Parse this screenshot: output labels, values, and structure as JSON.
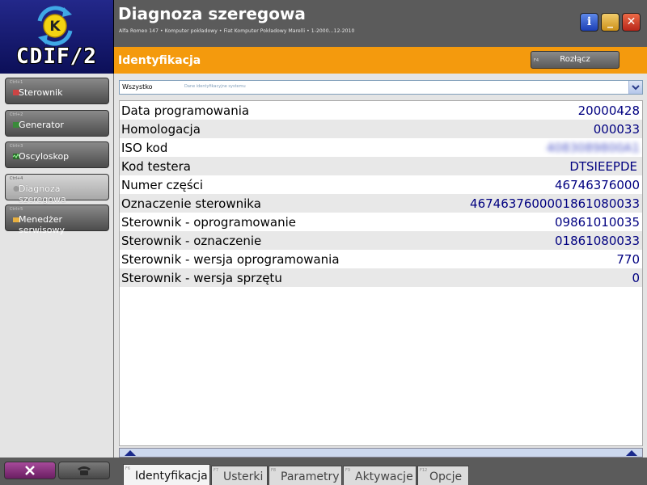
{
  "logo": {
    "text": "CDIF/2",
    "icon": "logo-k-icon"
  },
  "window": {
    "title": "Diagnoza szeregowa",
    "subtitle": "Alfa Romeo 147 • Komputer pokładowy • Fiat Komputer Pokładowy Marelli • 1-2000...12-2010",
    "buttons": {
      "info": "i",
      "minimize": "_",
      "close": "✕"
    }
  },
  "section": {
    "title": "Identyfikacja",
    "disconnect_key": "F4",
    "disconnect_label": "Rozłącz"
  },
  "sidebar": {
    "items": [
      {
        "key": "Ctrl+1",
        "label": "Sterownik",
        "icon": "chip-icon",
        "active": false
      },
      {
        "key": "Ctrl+2",
        "label": "Generator",
        "icon": "generator-icon",
        "active": false
      },
      {
        "key": "Ctrl+3",
        "label": "Oscyloskop",
        "icon": "oscilloscope-icon",
        "active": false
      },
      {
        "key": "Ctrl+4",
        "label": "Diagnoza szeregowa",
        "icon": "diagnosis-icon",
        "active": true
      },
      {
        "key": "Ctrl+5",
        "label": "Menedżer serwisowy",
        "icon": "folder-icon",
        "active": false
      }
    ]
  },
  "filter": {
    "value": "Wszystko",
    "placeholder": "Dane identyfikacyjne systemu"
  },
  "table": {
    "rows": [
      {
        "label": "Data programowania",
        "value": "20000428",
        "blurred": false
      },
      {
        "label": "Homologacja",
        "value": "000033",
        "blurred": false
      },
      {
        "label": "ISO kod",
        "value": "4083089800A1",
        "blurred": true
      },
      {
        "label": "Kod testera",
        "value": "DTSIEEPDE",
        "blurred": false
      },
      {
        "label": "Numer części",
        "value": "46746376000",
        "blurred": false
      },
      {
        "label": "Oznaczenie sterownika",
        "value": "4674637600001861080033",
        "blurred": false
      },
      {
        "label": "Sterownik - oprogramowanie",
        "value": "09861010035",
        "blurred": false
      },
      {
        "label": "Sterownik - oznaczenie",
        "value": "01861080033",
        "blurred": false
      },
      {
        "label": "Sterownik - wersja oprogramowania",
        "value": "770",
        "blurred": false
      },
      {
        "label": "Sterownik - wersja sprzętu",
        "value": "0",
        "blurred": false
      }
    ]
  },
  "bottom": {
    "tools_icon": "tools-icon",
    "phone_icon": "phone-icon",
    "tabs": [
      {
        "key": "F6",
        "label": "Identyfikacja",
        "active": true
      },
      {
        "key": "F7",
        "label": "Usterki",
        "active": false
      },
      {
        "key": "F8",
        "label": "Parametry",
        "active": false
      },
      {
        "key": "F9",
        "label": "Aktywacje",
        "active": false
      },
      {
        "key": "F12",
        "label": "Opcje",
        "active": false
      }
    ]
  },
  "colors": {
    "accent_orange": "#f49a0d",
    "value_blue": "#000080",
    "logo_blue": "#23288a",
    "tools_purple": "#8a3480"
  }
}
